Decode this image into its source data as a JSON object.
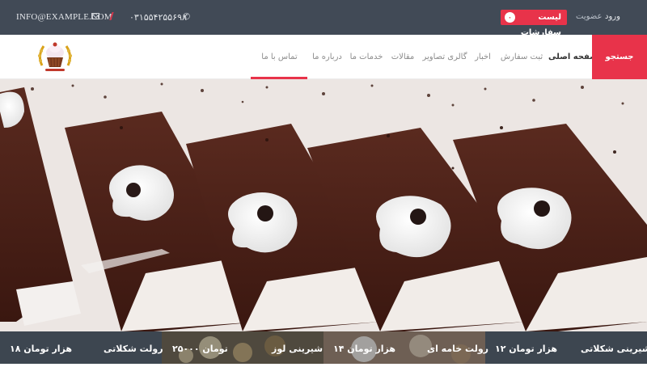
{
  "topbar": {
    "email": "INFO@EXAMPLE.COM",
    "phone": "۰۳۱۵۵۴۲۵۵۶۹۸",
    "cart_label": "لیست سفارشات",
    "cart_count": "۰",
    "membership": "عضویت",
    "login": "ورود"
  },
  "nav": {
    "search": "جستجو",
    "items": [
      "صفحه اصلی",
      "ثبت سفارش",
      "اخبار",
      "گالری تصاویر",
      "مقالات",
      "خدمات ما",
      "درباره ما",
      "تماس با ما"
    ]
  },
  "products": [
    {
      "name": "شیرینی شکلاتی",
      "price": "۱۲ هزار تومان"
    },
    {
      "name": "رولت خامه ای",
      "price": "۱۴ هزار تومان"
    },
    {
      "name": "شیرینی لوز",
      "price": "۲۵۰۰۰ تومان"
    },
    {
      "name": "رولت شکلاتی",
      "price": "۱۸ هزار تومان"
    }
  ],
  "colors": {
    "accent": "#e8334a",
    "topbar_bg": "#414a56",
    "footer_bg": "#3d4650"
  }
}
